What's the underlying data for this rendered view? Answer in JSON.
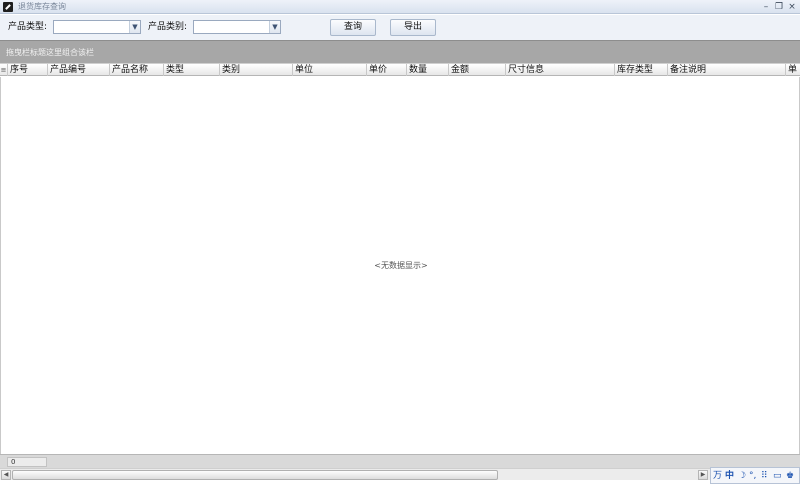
{
  "window": {
    "title": "退货库存查询",
    "minimize_glyph": "–",
    "restore_glyph": "❐",
    "close_glyph": "×"
  },
  "filters": {
    "product_type_label": "产品类型:",
    "product_type_value": "",
    "product_category_label": "产品类别:",
    "product_category_value": "",
    "query_button": "查询",
    "export_button": "导出"
  },
  "group_panel": {
    "hint": "拖曳栏标题这里组合该栏"
  },
  "grid": {
    "columns": [
      "序号",
      "产品编号",
      "产品名称",
      "类型",
      "类别",
      "单位",
      "单价",
      "数量",
      "金额",
      "尺寸信息",
      "库存类型",
      "备注说明",
      "单"
    ],
    "empty_message": "<无数据显示>"
  },
  "footer": {
    "summary_value": "0"
  },
  "ime": {
    "items": [
      "万",
      "中",
      "☽",
      "°,",
      "⠿",
      "▭",
      "♚"
    ]
  },
  "colors": {
    "toolbar_bg": "#eef2f8",
    "group_panel_bg": "#a7a7a7",
    "title_text": "#7a879a"
  }
}
